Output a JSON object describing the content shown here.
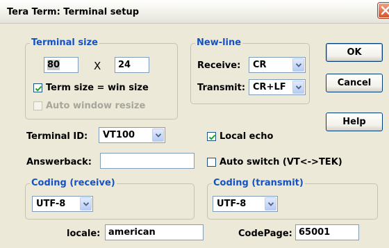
{
  "window": {
    "title": "Tera Term: Terminal setup"
  },
  "terminal_size": {
    "legend": "Terminal size",
    "cols": "80",
    "times": "X",
    "rows": "24",
    "term_size_label": "Term size = win size",
    "term_size_checked": true,
    "auto_resize_label": "Auto window resize",
    "auto_resize_checked": false
  },
  "new_line": {
    "legend": "New-line",
    "receive_label": "Receive:",
    "receive_value": "CR",
    "transmit_label": "Transmit:",
    "transmit_value": "CR+LF"
  },
  "buttons": {
    "ok": "OK",
    "cancel": "Cancel",
    "help": "Help"
  },
  "terminal_id": {
    "label": "Terminal ID:",
    "value": "VT100"
  },
  "local_echo": {
    "label": "Local echo",
    "checked": true
  },
  "answerback": {
    "label": "Answerback:",
    "value": ""
  },
  "auto_switch": {
    "label": "Auto switch (VT<->TEK)",
    "checked": false
  },
  "coding_receive": {
    "legend": "Coding (receive)",
    "value": "UTF-8"
  },
  "coding_transmit": {
    "legend": "Coding (transmit)",
    "value": "UTF-8"
  },
  "locale": {
    "label": "locale:",
    "value": "american"
  },
  "codepage": {
    "label": "CodePage:",
    "value": "65001"
  },
  "colors": {
    "legend_blue": "#1452c3",
    "dialog_bg": "#ece9d8"
  }
}
